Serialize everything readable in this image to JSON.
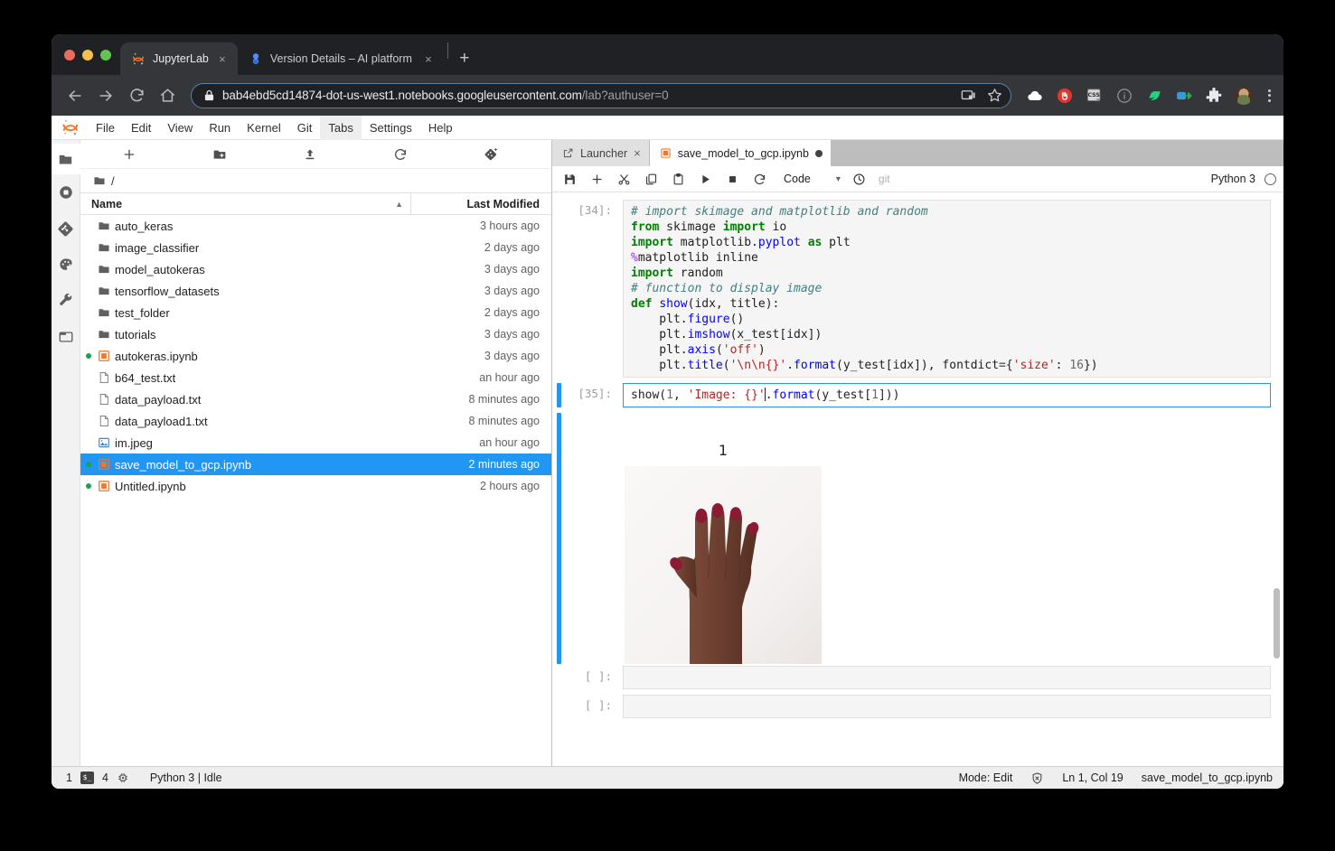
{
  "browser": {
    "tabs": [
      {
        "title": "JupyterLab",
        "favicon": "jupyter-icon",
        "active": true,
        "close_label": "×"
      },
      {
        "title": "Version Details – AI platform – (",
        "favicon": "gcp-ai-icon",
        "active": false,
        "close_label": "×"
      }
    ],
    "new_tab_label": "+",
    "nav": {
      "back": "←",
      "forward": "→",
      "reload": "⟳",
      "home": "⌂"
    },
    "omnibox": {
      "lock_icon": "lock-icon",
      "url_host": "bab4ebd5cd14874-dot-us-west1.notebooks.googleusercontent.com",
      "url_path": "/lab?authuser=0",
      "cast_icon": "cast-icon",
      "star_icon": "star-icon"
    },
    "extensions": [
      "cloud-icon",
      "stop-hand-icon",
      "css-icon",
      "info-icon",
      "bird-icon",
      "proxy-icon",
      "puzzle-icon"
    ],
    "profile_icon": "avatar",
    "menu_icon": "kebab-menu-icon"
  },
  "jupyter": {
    "logo": "jupyter-logo",
    "menu": [
      {
        "label": "File",
        "active": false
      },
      {
        "label": "Edit",
        "active": false
      },
      {
        "label": "View",
        "active": false
      },
      {
        "label": "Run",
        "active": false
      },
      {
        "label": "Kernel",
        "active": false
      },
      {
        "label": "Git",
        "active": false
      },
      {
        "label": "Tabs",
        "active": true
      },
      {
        "label": "Settings",
        "active": false
      },
      {
        "label": "Help",
        "active": false
      }
    ],
    "activity_bar": [
      {
        "name": "file-browser-icon",
        "active": true
      },
      {
        "name": "running-terminals-icon",
        "active": false
      },
      {
        "name": "git-icon",
        "active": false
      },
      {
        "name": "extension-manager-icon",
        "active": false
      },
      {
        "name": "property-inspector-icon",
        "active": false
      },
      {
        "name": "open-tabs-icon",
        "active": false
      }
    ],
    "file_browser": {
      "toolbar": [
        "new-launcher-icon",
        "new-folder-icon",
        "upload-icon",
        "refresh-icon",
        "new-checkpoint-icon"
      ],
      "breadcrumb": {
        "icon": "folder-icon",
        "path": "/"
      },
      "columns": {
        "name": "Name",
        "last_modified": "Last Modified",
        "sort": "ascending"
      },
      "items": [
        {
          "name": "auto_keras",
          "modified": "3 hours ago",
          "type": "folder",
          "dirty": false,
          "selected": false
        },
        {
          "name": "image_classifier",
          "modified": "2 days ago",
          "type": "folder",
          "dirty": false,
          "selected": false
        },
        {
          "name": "model_autokeras",
          "modified": "3 days ago",
          "type": "folder",
          "dirty": false,
          "selected": false
        },
        {
          "name": "tensorflow_datasets",
          "modified": "3 days ago",
          "type": "folder",
          "dirty": false,
          "selected": false
        },
        {
          "name": "test_folder",
          "modified": "2 days ago",
          "type": "folder",
          "dirty": false,
          "selected": false
        },
        {
          "name": "tutorials",
          "modified": "3 days ago",
          "type": "folder",
          "dirty": false,
          "selected": false
        },
        {
          "name": "autokeras.ipynb",
          "modified": "3 days ago",
          "type": "notebook",
          "dirty": true,
          "selected": false
        },
        {
          "name": "b64_test.txt",
          "modified": "an hour ago",
          "type": "text",
          "dirty": false,
          "selected": false
        },
        {
          "name": "data_payload.txt",
          "modified": "8 minutes ago",
          "type": "text",
          "dirty": false,
          "selected": false
        },
        {
          "name": "data_payload1.txt",
          "modified": "8 minutes ago",
          "type": "text",
          "dirty": false,
          "selected": false
        },
        {
          "name": "im.jpeg",
          "modified": "an hour ago",
          "type": "image",
          "dirty": false,
          "selected": false
        },
        {
          "name": "save_model_to_gcp.ipynb",
          "modified": "2 minutes ago",
          "type": "notebook",
          "dirty": true,
          "selected": true
        },
        {
          "name": "Untitled.ipynb",
          "modified": "2 hours ago",
          "type": "notebook",
          "dirty": true,
          "selected": false
        }
      ]
    },
    "notebook": {
      "tabs": [
        {
          "label": "Launcher",
          "icon": "launcher-icon",
          "active": false,
          "close": "×",
          "dirty": false
        },
        {
          "label": "save_model_to_gcp.ipynb",
          "icon": "notebook-icon",
          "active": true,
          "close": "",
          "dirty": true
        }
      ],
      "toolbar": {
        "buttons": [
          "save-icon",
          "insert-cell-icon",
          "cut-icon",
          "copy-icon",
          "paste-icon",
          "run-icon",
          "stop-icon",
          "restart-icon"
        ],
        "cell_type": "Code",
        "cell_type_caret": "⌄",
        "history_icon": "clock-icon",
        "git_label": "git",
        "kernel_name": "Python 3",
        "kernel_status": "idle"
      },
      "cells": [
        {
          "prompt": "[34]:",
          "active": false,
          "lines": [
            [
              {
                "t": "# import skimage and matplotlib and random",
                "c": "cmt"
              }
            ],
            [
              {
                "t": "from",
                "c": "kw"
              },
              {
                "t": " skimage ",
                "c": ""
              },
              {
                "t": "import",
                "c": "kw"
              },
              {
                "t": " io",
                "c": ""
              }
            ],
            [
              {
                "t": "import",
                "c": "kw"
              },
              {
                "t": " matplotlib.",
                "c": ""
              },
              {
                "t": "pyplot",
                "c": "fn"
              },
              {
                "t": " ",
                "c": ""
              },
              {
                "t": "as",
                "c": "kw"
              },
              {
                "t": " plt",
                "c": ""
              }
            ],
            [
              {
                "t": "%",
                "c": "mag"
              },
              {
                "t": "matplotlib inline",
                "c": ""
              }
            ],
            [
              {
                "t": "import",
                "c": "kw"
              },
              {
                "t": " random",
                "c": ""
              }
            ],
            [
              {
                "t": "",
                "c": ""
              }
            ],
            [
              {
                "t": "# function to display image",
                "c": "cmt"
              }
            ],
            [
              {
                "t": "def",
                "c": "kw"
              },
              {
                "t": " ",
                "c": ""
              },
              {
                "t": "show",
                "c": "fn"
              },
              {
                "t": "(idx, title):",
                "c": ""
              }
            ],
            [
              {
                "t": "    plt.",
                "c": ""
              },
              {
                "t": "figure",
                "c": "fn"
              },
              {
                "t": "()",
                "c": ""
              }
            ],
            [
              {
                "t": "    plt.",
                "c": ""
              },
              {
                "t": "imshow",
                "c": "fn"
              },
              {
                "t": "(x_test[idx])",
                "c": ""
              }
            ],
            [
              {
                "t": "    plt.",
                "c": ""
              },
              {
                "t": "axis",
                "c": "fn"
              },
              {
                "t": "(",
                "c": ""
              },
              {
                "t": "'off'",
                "c": "str"
              },
              {
                "t": ")",
                "c": ""
              }
            ],
            [
              {
                "t": "    plt.",
                "c": ""
              },
              {
                "t": "title",
                "c": "fn"
              },
              {
                "t": "(",
                "c": ""
              },
              {
                "t": "'\\n\\n{}'",
                "c": "str"
              },
              {
                "t": ".",
                "c": ""
              },
              {
                "t": "format",
                "c": "fn"
              },
              {
                "t": "(y_test[idx]), fontdict",
                "c": ""
              },
              {
                "t": "=",
                "c": "op"
              },
              {
                "t": "{",
                "c": ""
              },
              {
                "t": "'size'",
                "c": "str"
              },
              {
                "t": ": ",
                "c": ""
              },
              {
                "t": "16",
                "c": "num"
              },
              {
                "t": "})",
                "c": ""
              }
            ]
          ]
        },
        {
          "prompt": "[35]:",
          "active": true,
          "lines": [
            [
              {
                "t": "show(",
                "c": ""
              },
              {
                "t": "1",
                "c": "num"
              },
              {
                "t": ", ",
                "c": ""
              },
              {
                "t": "'Image: {}'",
                "c": "str"
              },
              {
                "t": "|CURSOR|",
                "c": "cursor"
              },
              {
                "t": ".",
                "c": ""
              },
              {
                "t": "format",
                "c": "fn"
              },
              {
                "t": "(y_test[",
                "c": ""
              },
              {
                "t": "1",
                "c": "num"
              },
              {
                "t": "]))",
                "c": ""
              }
            ]
          ],
          "output": {
            "type": "image",
            "figure_title": "1",
            "alt": "photo of an open hand with five fingers extended on a white background"
          }
        },
        {
          "prompt": "[ ]:",
          "active": false,
          "empty": true
        },
        {
          "prompt": "[ ]:",
          "active": false,
          "empty": true
        }
      ]
    },
    "status_bar": {
      "terminal_count": "1",
      "terminal_icon": "terminal-icon",
      "kernel_count": "4",
      "kernel_icon": "kernel-chip-icon",
      "kernel_status": "Python 3 | Idle",
      "mode": "Mode: Edit",
      "shield_icon": "trust-shield-icon",
      "cursor_position": "Ln 1, Col 19",
      "file_name": "save_model_to_gcp.ipynb"
    }
  }
}
